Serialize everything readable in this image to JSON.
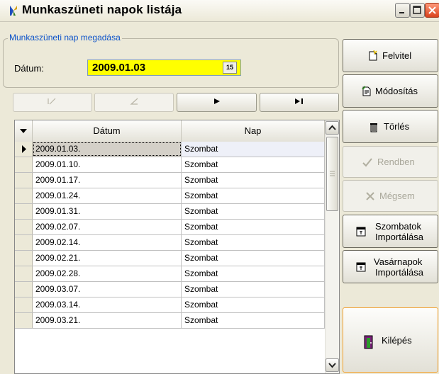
{
  "window": {
    "title": "Munkaszüneti napok listája"
  },
  "form": {
    "group_label": "Munkaszüneti nap megadása",
    "datum_label": "Dátum:",
    "datum_value": "2009.01.03",
    "calendar_label": "15"
  },
  "nav": {
    "first": "⏮",
    "prev": "◀",
    "next": "▶",
    "last": "▶|"
  },
  "grid": {
    "columns": [
      "Dátum",
      "Nap"
    ],
    "rows": [
      {
        "datum": "2009.01.03.",
        "nap": "Szombat"
      },
      {
        "datum": "2009.01.10.",
        "nap": "Szombat"
      },
      {
        "datum": "2009.01.17.",
        "nap": "Szombat"
      },
      {
        "datum": "2009.01.24.",
        "nap": "Szombat"
      },
      {
        "datum": "2009.01.31.",
        "nap": "Szombat"
      },
      {
        "datum": "2009.02.07.",
        "nap": "Szombat"
      },
      {
        "datum": "2009.02.14.",
        "nap": "Szombat"
      },
      {
        "datum": "2009.02.21.",
        "nap": "Szombat"
      },
      {
        "datum": "2009.02.28.",
        "nap": "Szombat"
      },
      {
        "datum": "2009.03.07.",
        "nap": "Szombat"
      },
      {
        "datum": "2009.03.14.",
        "nap": "Szombat"
      },
      {
        "datum": "2009.03.21.",
        "nap": "Szombat"
      }
    ]
  },
  "buttons": {
    "felvitel": "Felvitel",
    "modositas": "Módosítás",
    "torles": "Törlés",
    "rendben": "Rendben",
    "megsem": "Mégsem",
    "szombatok_line1": "Szombatok",
    "szombatok_line2": "Importálása",
    "vasarnapok_line1": "Vasárnapok",
    "vasarnapok_line2": "Importálása",
    "kilepes": "Kilépés"
  },
  "colors": {
    "date_field_bg": "#ffff00",
    "group_label": "#0b52c9",
    "window_bg": "#ece9d8"
  }
}
